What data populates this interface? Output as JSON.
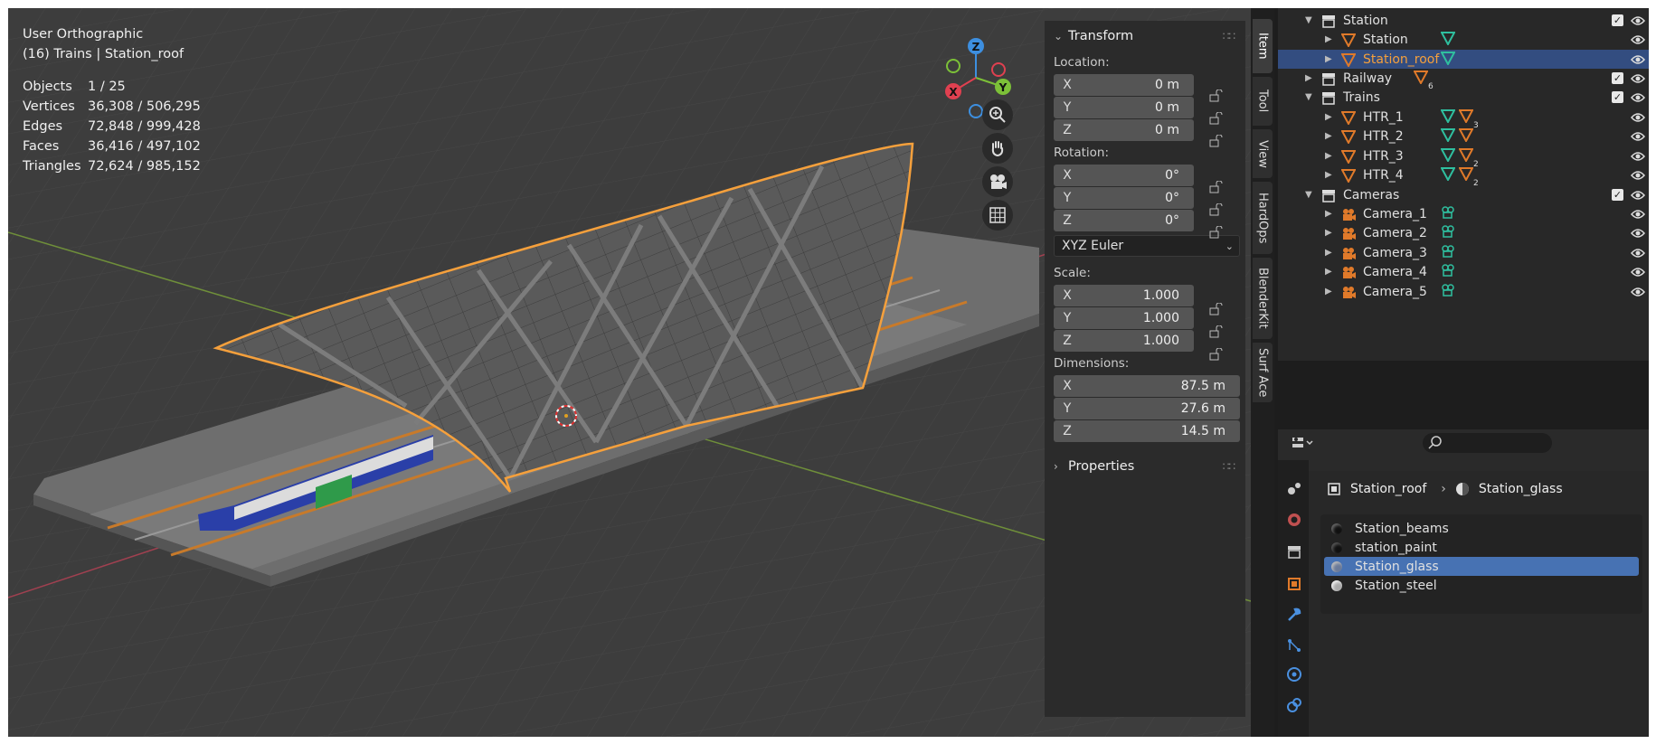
{
  "viewport": {
    "view_name": "User Orthographic",
    "context": "(16) Trains | Station_roof",
    "stats": [
      {
        "k": "Objects",
        "v": "1 / 25"
      },
      {
        "k": "Vertices",
        "v": "36,308 / 506,295"
      },
      {
        "k": "Edges",
        "v": "72,848 / 999,428"
      },
      {
        "k": "Faces",
        "v": "36,416 / 497,102"
      },
      {
        "k": "Triangles",
        "v": "72,624 / 985,152"
      }
    ],
    "gizmo": {
      "z": "Z",
      "y": "Y",
      "x": "X"
    }
  },
  "npanel": {
    "transform_title": "Transform",
    "location_label": "Location:",
    "location": [
      {
        "ax": "X",
        "v": "0 m"
      },
      {
        "ax": "Y",
        "v": "0 m"
      },
      {
        "ax": "Z",
        "v": "0 m"
      }
    ],
    "rotation_label": "Rotation:",
    "rotation": [
      {
        "ax": "X",
        "v": "0°"
      },
      {
        "ax": "Y",
        "v": "0°"
      },
      {
        "ax": "Z",
        "v": "0°"
      }
    ],
    "rotation_mode": "XYZ Euler",
    "scale_label": "Scale:",
    "scale": [
      {
        "ax": "X",
        "v": "1.000"
      },
      {
        "ax": "Y",
        "v": "1.000"
      },
      {
        "ax": "Z",
        "v": "1.000"
      }
    ],
    "dimensions_label": "Dimensions:",
    "dimensions": [
      {
        "ax": "X",
        "v": "87.5 m"
      },
      {
        "ax": "Y",
        "v": "27.6 m"
      },
      {
        "ax": "Z",
        "v": "14.5 m"
      }
    ],
    "properties_title": "Properties"
  },
  "vtabs": [
    "Item",
    "Tool",
    "View",
    "HardOps",
    "BlenderKit",
    "Surf Ace"
  ],
  "outliner": {
    "rows": [
      {
        "name": "Station",
        "type": "collection"
      },
      {
        "name": "Station",
        "type": "object"
      },
      {
        "name": "Station_roof",
        "type": "object"
      },
      {
        "name": "Railway",
        "type": "collection",
        "badge": "6"
      },
      {
        "name": "Trains",
        "type": "collection"
      },
      {
        "name": "HTR_1",
        "type": "object",
        "badge": "3"
      },
      {
        "name": "HTR_2",
        "type": "object"
      },
      {
        "name": "HTR_3",
        "type": "object",
        "badge": "2"
      },
      {
        "name": "HTR_4",
        "type": "object",
        "badge": "2"
      },
      {
        "name": "Cameras",
        "type": "collection"
      },
      {
        "name": "Camera_1",
        "type": "camera"
      },
      {
        "name": "Camera_2",
        "type": "camera"
      },
      {
        "name": "Camera_3",
        "type": "camera"
      },
      {
        "name": "Camera_4",
        "type": "camera"
      },
      {
        "name": "Camera_5",
        "type": "camera"
      }
    ]
  },
  "properties": {
    "breadcrumb_object": "Station_roof",
    "breadcrumb_material": "Station_glass",
    "materials": [
      "Station_beams",
      "station_paint",
      "Station_glass",
      "Station_steel"
    ],
    "selected_material": "Station_glass"
  },
  "colors": {
    "selection_outline": "#f5a03c",
    "outliner_selected": "#334d80",
    "material_selected": "#4772b3",
    "axis_x": "#e04050",
    "axis_y": "#7cc038",
    "axis_z": "#3d8fe0"
  }
}
